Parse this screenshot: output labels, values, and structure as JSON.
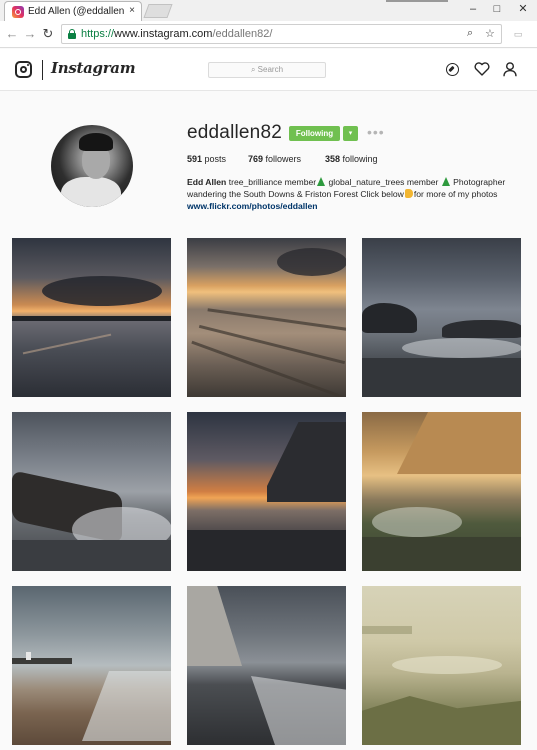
{
  "browser": {
    "tab_title": "Edd Allen (@eddallen82)",
    "tab_close": "×",
    "url_scheme": "https://",
    "url_host": "www.instagram.com",
    "url_path": "/eddallen82/",
    "window_controls": [
      "minimize",
      "maximize",
      "close"
    ]
  },
  "header": {
    "brand": "Instagram",
    "search_placeholder": "Search",
    "icons": [
      "compass-icon",
      "heart-icon",
      "user-icon"
    ]
  },
  "profile": {
    "username": "eddallen82",
    "follow_label": "Following",
    "dropdown_label": "▾",
    "more_label": "•••",
    "posts_count": "591",
    "posts_label": "posts",
    "followers_count": "769",
    "followers_label": "followers",
    "following_count": "358",
    "following_label": "following",
    "bio_name": "Edd Allen",
    "bio_part1": "tree_brilliance member",
    "bio_part2": "global_nature_trees member",
    "bio_part3": "Photographer wandering the South Downs & Friston Forest Click below",
    "bio_part4": "for more of my photos",
    "bio_link": "www.flickr.com/photos/eddallen"
  },
  "colors": {
    "follow_green": "#70c050",
    "link_blue": "#003569",
    "secure_green": "#0b8043"
  },
  "posts": [
    {
      "alt": "sunset over beach with clouds"
    },
    {
      "alt": "rippled sand at sunset"
    },
    {
      "alt": "rocky shore under stormy sky"
    },
    {
      "alt": "waves over rocks"
    },
    {
      "alt": "sunset by chalk cliff"
    },
    {
      "alt": "golden cliffs over rock pools"
    },
    {
      "alt": "lighthouse on shingle beach"
    },
    {
      "alt": "cliffs and surf at dusk"
    },
    {
      "alt": "misty marsh grasses"
    }
  ]
}
